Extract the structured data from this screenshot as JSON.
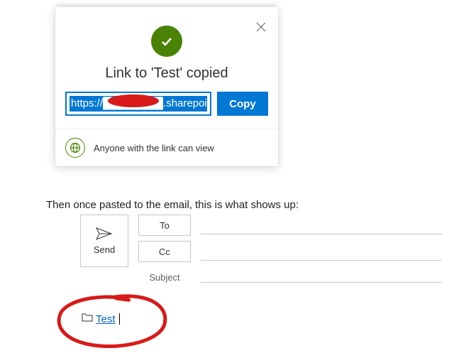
{
  "dialog": {
    "title": "Link to 'Test' copied",
    "link_text": "https://████████.sharepoi",
    "copy_label": "Copy",
    "permission_text": "Anyone with the link can view"
  },
  "caption": "Then once pasted to the email, this is what shows up:",
  "compose": {
    "send_label": "Send",
    "to_label": "To",
    "cc_label": "Cc",
    "subject_label": "Subject"
  },
  "link_preview": {
    "text": "Test"
  }
}
